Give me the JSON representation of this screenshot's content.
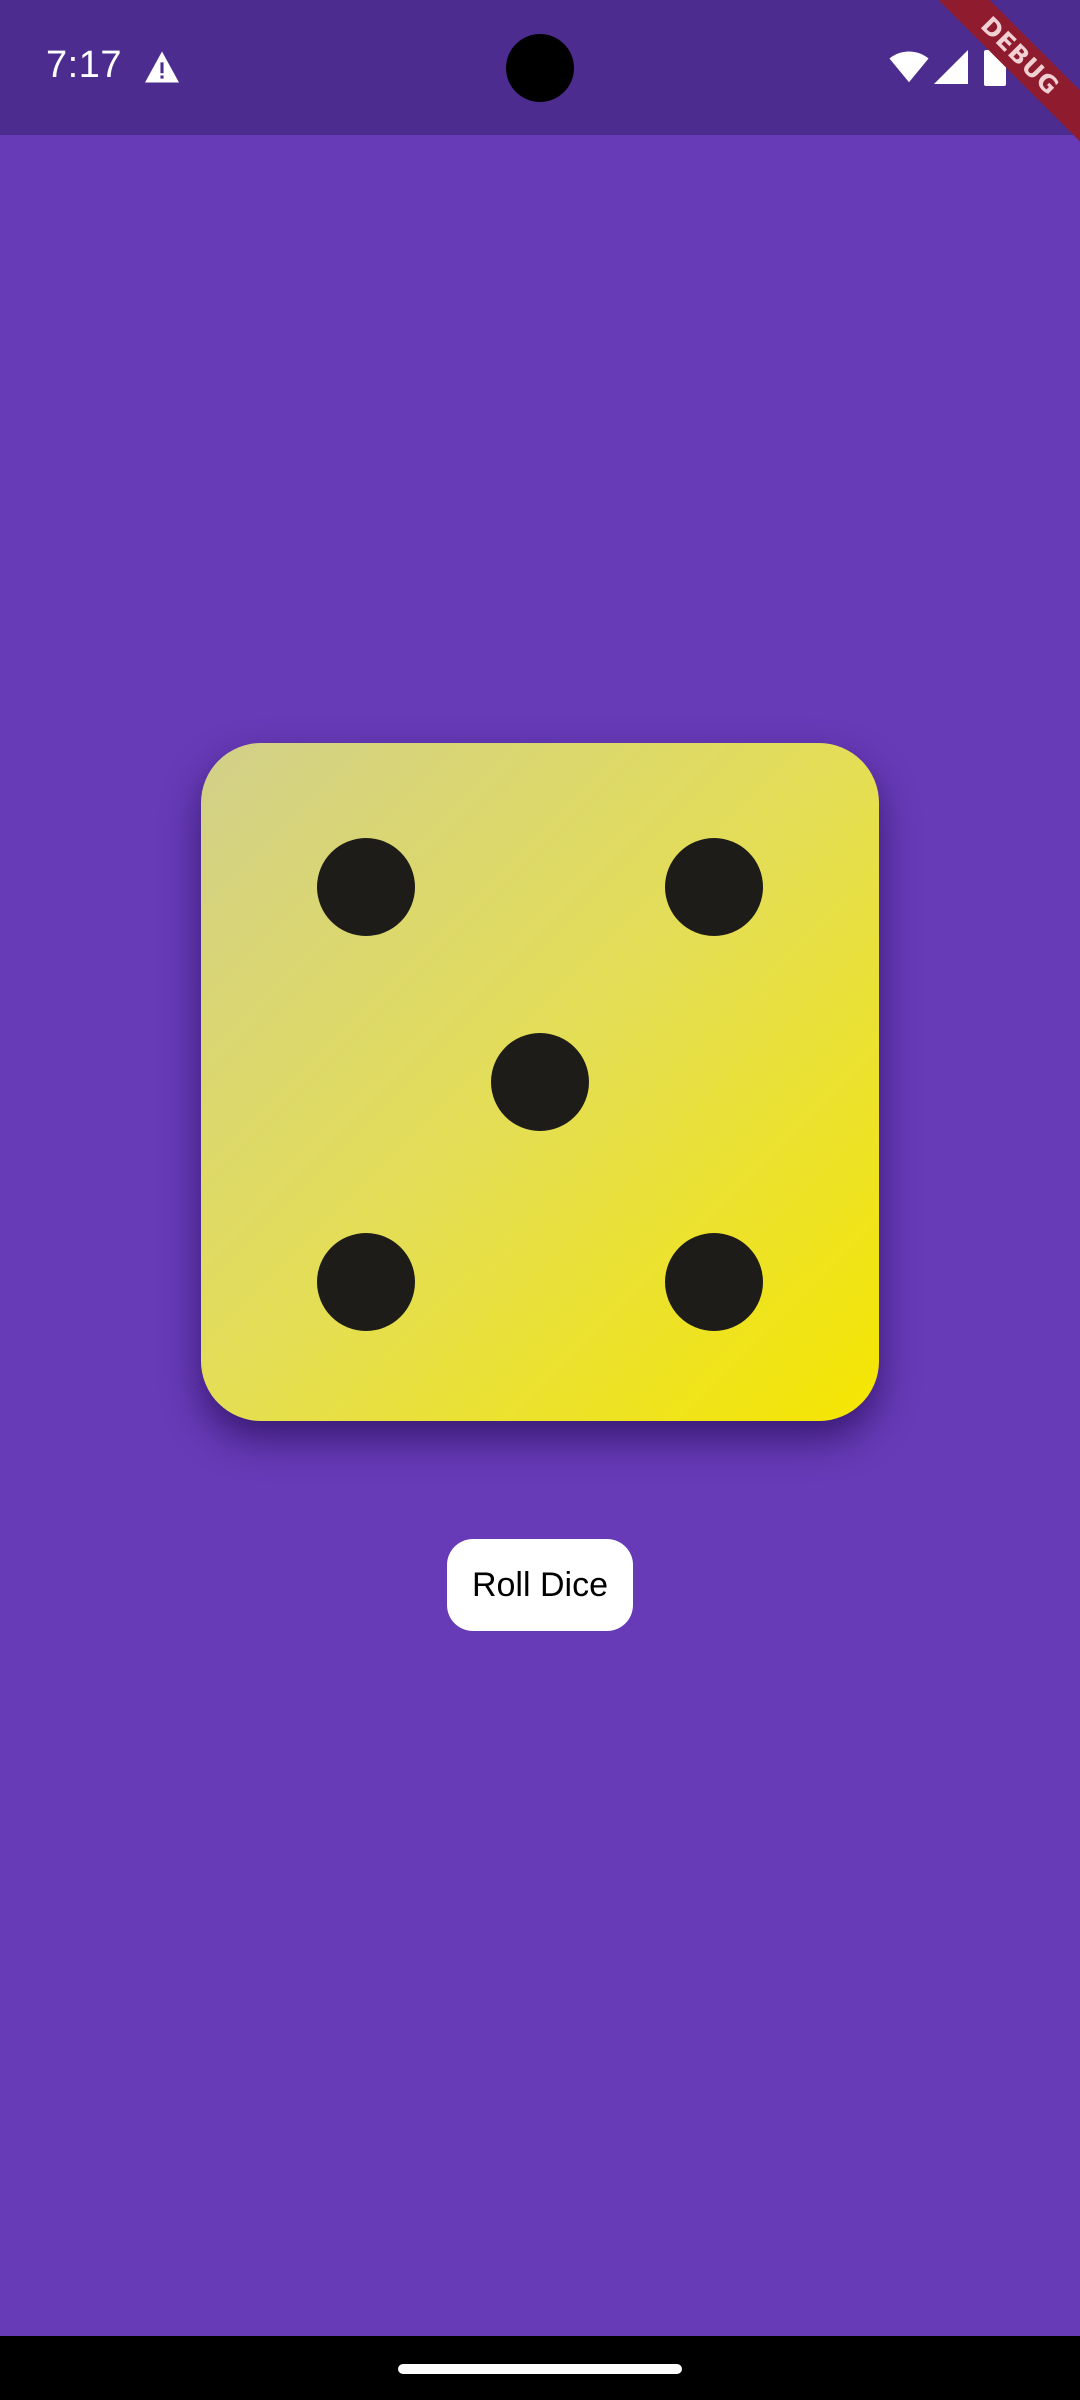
{
  "status_bar": {
    "time": "7:17",
    "icons": [
      "warning-icon",
      "wifi-icon",
      "signal-icon",
      "battery-icon"
    ]
  },
  "debug_banner": {
    "label": "DEBUG"
  },
  "dice": {
    "face_value": 5,
    "pips": [
      "top-left",
      "top-right",
      "center",
      "bottom-left",
      "bottom-right"
    ]
  },
  "roll_button": {
    "label": "Roll Dice"
  },
  "colors": {
    "background": "#673ab7",
    "status_bar": "#4d2c90",
    "dice_gradient_start": "#d2d08a",
    "dice_gradient_end": "#f5e600",
    "pip": "#1e1c18",
    "button_bg": "#ffffff",
    "debug_ribbon": "#8e1b2e"
  }
}
